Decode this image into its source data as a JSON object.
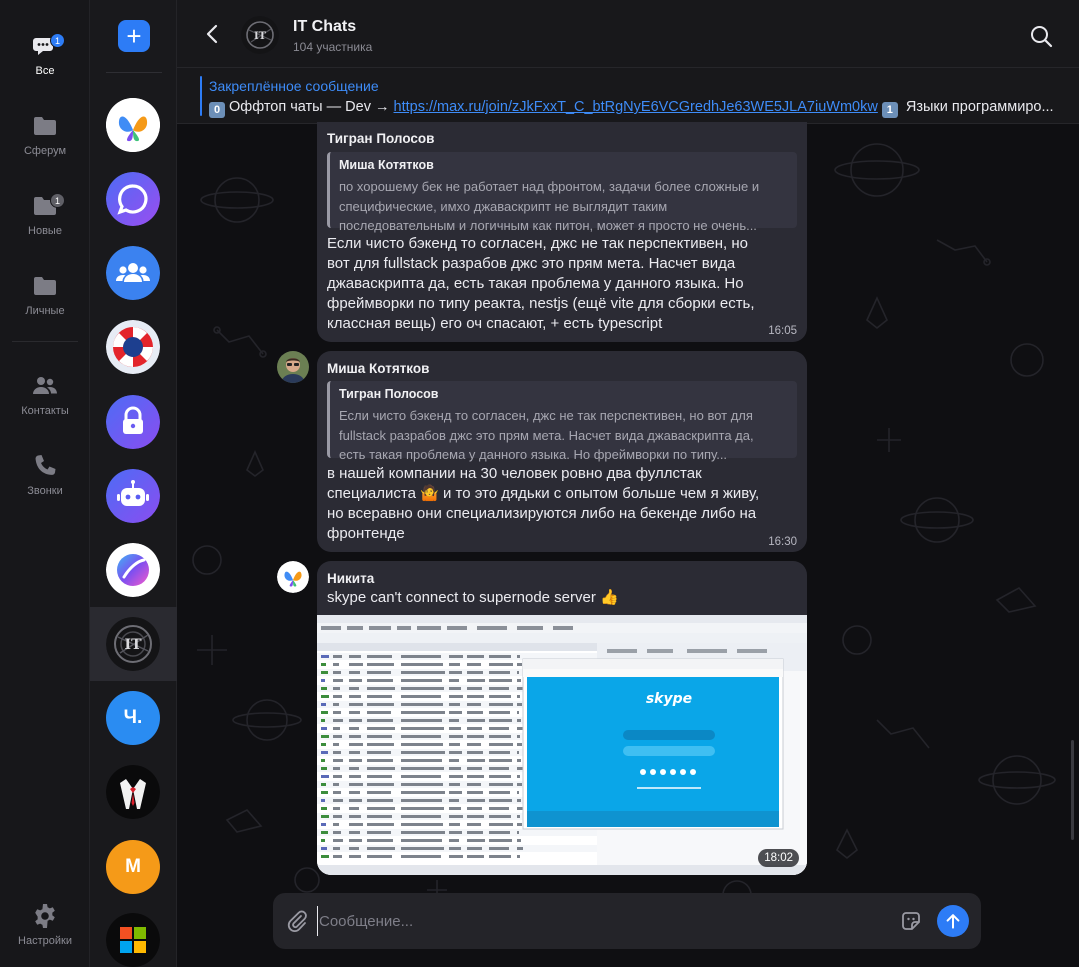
{
  "nav": {
    "all_label": "Все",
    "all_badge": "1",
    "spheres_label": "Сферум",
    "new_label": "Новые",
    "new_badge": "1",
    "personal_label": "Личные",
    "contacts_label": "Контакты",
    "calls_label": "Звонки",
    "settings_label": "Настройки"
  },
  "chat_list": {
    "new_chat_symbol": "+",
    "letter_avatars": [
      {
        "letter": "Ч.",
        "color": "#2a8cf2"
      },
      {
        "letter": "M",
        "color": "#f59a18"
      }
    ]
  },
  "header": {
    "title": "IT Chats",
    "subtitle": "104 участника"
  },
  "pinned": {
    "title": "Закреплённое сообщение",
    "num1": "0",
    "text_before": "Оффтоп чаты — Dev → ",
    "link": "https://max.ru/join/zJkFxxT_C_btRgNyE6VCGredhJe63WE5JLA7iuWm0kw",
    "num2": "1",
    "text_after": " Языки программиро..."
  },
  "messages": [
    {
      "sender": "Тигран Полосов",
      "reply_name": "Миша Котятков",
      "reply_lines": [
        "по хорошему бек не работает над фронтом, задачи более сложные и",
        "специфические, имхо джаваскрипт не выглядит таким",
        "последовательным и логичным как питон, может я просто не очень..."
      ],
      "body_lines": [
        "Если чисто бэкенд то согласен, джс не так перспективен, но",
        "вот для fullstack разрабов джс это прям мета. Насчет вида",
        "джаваскрипта да, есть такая проблема у данного языка. Но",
        "фреймворки по типу реакта, nestjs (ещё vite для сборки есть,",
        "классная вещь) его оч спасают, + есть typescript"
      ],
      "time": "16:05"
    },
    {
      "sender": "Миша Котятков",
      "reply_name": "Тигран Полосов",
      "reply_lines": [
        "Если чисто бэкенд то согласен, джс не так перспективен, но вот для",
        "fullstack разрабов джс это прям мета. Насчет вида джаваскрипта да,",
        "есть такая проблема у данного языка. Но фреймворки по типу..."
      ],
      "body_lines": [
        "в нашей компании на 30 человек ровно два фуллстак",
        "специалиста 🤷 и то это дядьки с опытом больше чем я живу,",
        "но всеравно они специализируются либо на бекенде либо на",
        "фронтенде"
      ],
      "time": "16:30"
    },
    {
      "sender": "Никита",
      "body": "skype can't connect to supernode server 👍",
      "time": "18:02"
    }
  ],
  "composer": {
    "placeholder": "Сообщение..."
  }
}
